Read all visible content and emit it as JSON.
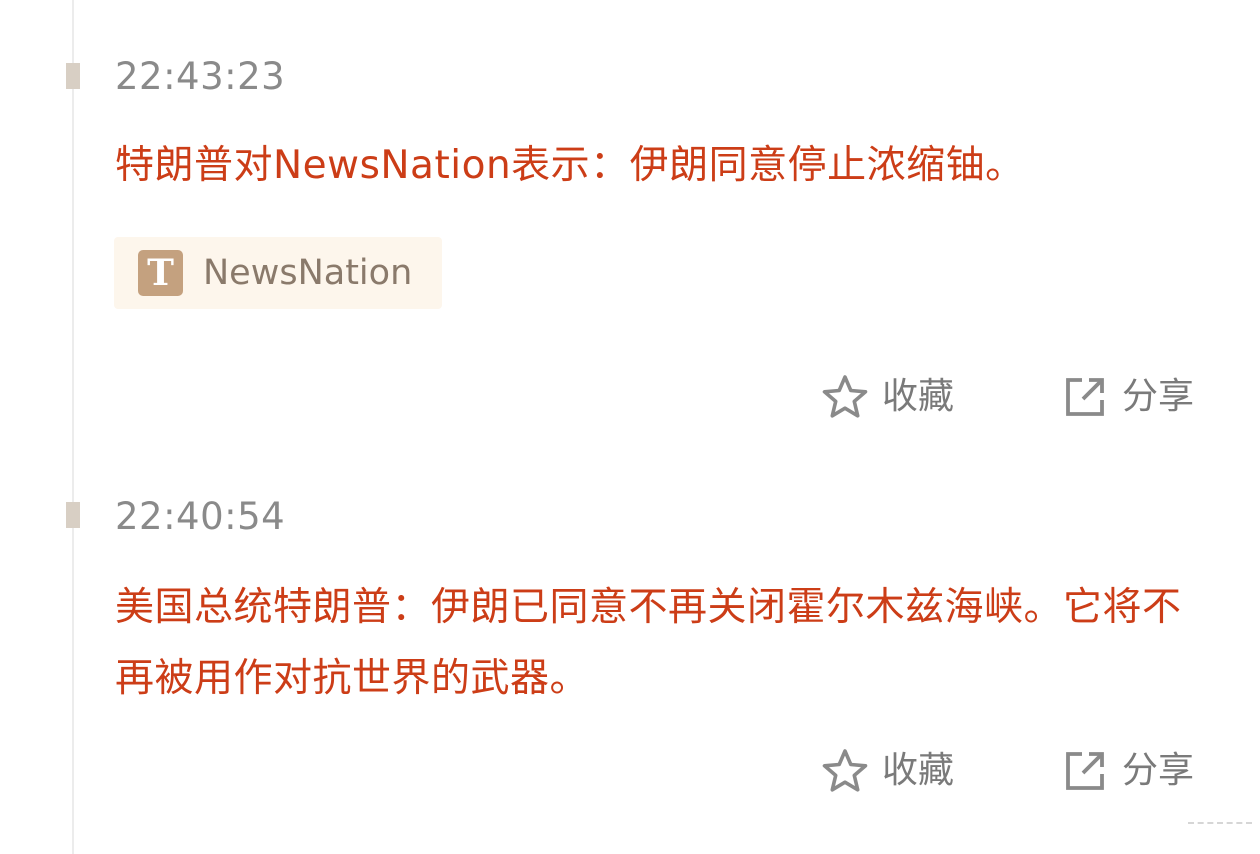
{
  "feed": {
    "items": [
      {
        "time": "22:43:23",
        "headline": "特朗普对NewsNation表示：伊朗同意停止浓缩铀。",
        "tag": {
          "icon_text": "T",
          "label": "NewsNation"
        },
        "actions": {
          "favorite_label": "收藏",
          "share_label": "分享"
        }
      },
      {
        "time": "22:40:54",
        "headline": "美国总统特朗普：伊朗已同意不再关闭霍尔木兹海峡。它将不再被用作对抗世界的武器。",
        "actions": {
          "favorite_label": "收藏",
          "share_label": "分享"
        }
      }
    ]
  },
  "colors": {
    "headline": "#cc3d17",
    "timestamp": "#8a8a8a",
    "tag_background": "#fdf6ec",
    "tag_icon": "#c4a17f",
    "marker": "#d8cfc4",
    "action_text": "#7a7a7a"
  },
  "icons": {
    "favorite": "star-outline-icon",
    "share": "external-share-icon",
    "source": "source-logo-icon"
  }
}
